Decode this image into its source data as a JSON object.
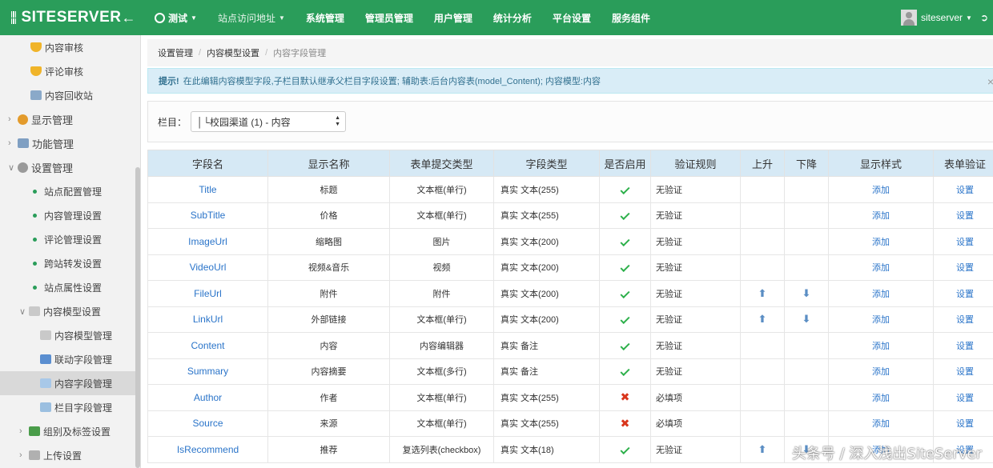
{
  "brand": {
    "name": "SITESERVER"
  },
  "topnav": [
    {
      "label": "测试",
      "type": "site"
    },
    {
      "label": "站点访问地址",
      "type": "dropdown"
    },
    {
      "label": "系统管理"
    },
    {
      "label": "管理员管理"
    },
    {
      "label": "用户管理"
    },
    {
      "label": "统计分析"
    },
    {
      "label": "平台设置"
    },
    {
      "label": "服务组件"
    }
  ],
  "user": {
    "name": "siteserver"
  },
  "sidebar": {
    "items": [
      {
        "label": "内容审核",
        "level": 2,
        "icon": "shield-icon"
      },
      {
        "label": "评论审核",
        "level": 2,
        "icon": "shield-icon"
      },
      {
        "label": "内容回收站",
        "level": 2,
        "icon": "recycle-icon"
      },
      {
        "label": "显示管理",
        "level": 1,
        "icon": "palette-icon"
      },
      {
        "label": "功能管理",
        "level": 1,
        "icon": "wrench-icon"
      },
      {
        "label": "设置管理",
        "level": 1,
        "icon": "gear-icon",
        "expanded": true
      },
      {
        "label": "站点配置管理",
        "level": 3
      },
      {
        "label": "内容管理设置",
        "level": 3
      },
      {
        "label": "评论管理设置",
        "level": 3
      },
      {
        "label": "跨站转发设置",
        "level": 3
      },
      {
        "label": "站点属性设置",
        "level": 3
      },
      {
        "label": "内容模型设置",
        "level": 3,
        "expanded": true,
        "icon": "doc-icon"
      },
      {
        "label": "内容模型管理",
        "level": 4,
        "icon": "doc-icon"
      },
      {
        "label": "联动字段管理",
        "level": 4,
        "icon": "chart-icon"
      },
      {
        "label": "内容字段管理",
        "level": 4,
        "icon": "edit-doc-icon",
        "active": true
      },
      {
        "label": "栏目字段管理",
        "level": 4,
        "icon": "grid-doc-icon"
      },
      {
        "label": "组别及标签设置",
        "level": 3,
        "icon": "tree-icon"
      },
      {
        "label": "上传设置",
        "level": 3,
        "icon": "upload-icon"
      }
    ]
  },
  "breadcrumb": {
    "items": [
      "设置管理",
      "内容模型设置"
    ],
    "current": "内容字段管理"
  },
  "alert": {
    "title": "提示!",
    "text": "在此编辑内容模型字段,子栏目默认继承父栏目字段设置; 辅助表:后台内容表(model_Content); 内容模型:内容"
  },
  "filter": {
    "label": "栏目：",
    "value": "│└校园渠道 (1) - 内容"
  },
  "table": {
    "headers": [
      "字段名",
      "显示名称",
      "表单提交类型",
      "字段类型",
      "是否启用",
      "验证规则",
      "上升",
      "下降",
      "显示样式",
      "表单验证"
    ],
    "add_label": "添加",
    "set_label": "设置",
    "rows": [
      {
        "field": "Title",
        "display": "标题",
        "input": "文本框(单行)",
        "type": "真实 文本(255)",
        "enabled": true,
        "rule": "无验证",
        "move": false
      },
      {
        "field": "SubTitle",
        "display": "价格",
        "input": "文本框(单行)",
        "type": "真实 文本(255)",
        "enabled": true,
        "rule": "无验证",
        "move": false
      },
      {
        "field": "ImageUrl",
        "display": "缩略图",
        "input": "图片",
        "type": "真实 文本(200)",
        "enabled": true,
        "rule": "无验证",
        "move": false
      },
      {
        "field": "VideoUrl",
        "display": "视频&音乐",
        "input": "视频",
        "type": "真实 文本(200)",
        "enabled": true,
        "rule": "无验证",
        "move": false
      },
      {
        "field": "FileUrl",
        "display": "附件",
        "input": "附件",
        "type": "真实 文本(200)",
        "enabled": true,
        "rule": "无验证",
        "move": true
      },
      {
        "field": "LinkUrl",
        "display": "外部链接",
        "input": "文本框(单行)",
        "type": "真实 文本(200)",
        "enabled": true,
        "rule": "无验证",
        "move": true
      },
      {
        "field": "Content",
        "display": "内容",
        "input": "内容编辑器",
        "type": "真实 备注",
        "enabled": true,
        "rule": "无验证",
        "move": false
      },
      {
        "field": "Summary",
        "display": "内容摘要",
        "input": "文本框(多行)",
        "type": "真实 备注",
        "enabled": true,
        "rule": "无验证",
        "move": false
      },
      {
        "field": "Author",
        "display": "作者",
        "input": "文本框(单行)",
        "type": "真实 文本(255)",
        "enabled": false,
        "rule": "必填项",
        "move": false
      },
      {
        "field": "Source",
        "display": "来源",
        "input": "文本框(单行)",
        "type": "真实 文本(255)",
        "enabled": false,
        "rule": "必填项",
        "move": false
      },
      {
        "field": "IsRecommend",
        "display": "推荐",
        "input": "复选列表(checkbox)",
        "type": "真实 文本(18)",
        "enabled": true,
        "rule": "无验证",
        "move": true
      }
    ]
  },
  "watermark": "头条号 / 深入浅出SiteServer",
  "colors": {
    "topbar": "#2a9d5a",
    "header_row": "#d6e9f5",
    "link": "#2a74c9",
    "check": "#2db04b",
    "cross": "#d9361c"
  }
}
